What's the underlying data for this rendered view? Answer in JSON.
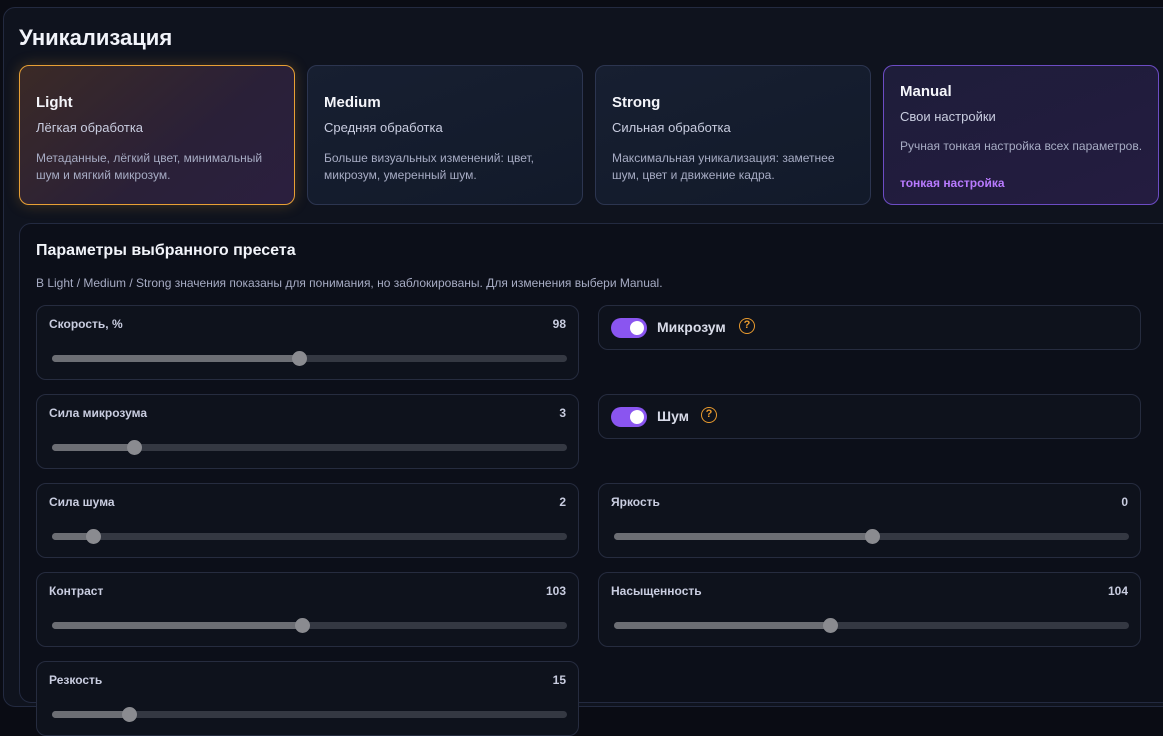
{
  "page": {
    "title": "Уникализация"
  },
  "presets": [
    {
      "name": "Light",
      "subtitle": "Лёгкая обработка",
      "description": "Метаданные, лёгкий цвет, минимальный шум и мягкий микрозум.",
      "active": true
    },
    {
      "name": "Medium",
      "subtitle": "Средняя обработка",
      "description": "Больше визуальных изменений: цвет, микрозум, умеренный шум.",
      "active": false
    },
    {
      "name": "Strong",
      "subtitle": "Сильная обработка",
      "description": "Максимальная уникализация: заметнее шум, цвет и движение кадра.",
      "active": false
    },
    {
      "name": "Manual",
      "subtitle": "Свои настройки",
      "description": "Ручная тонкая настройка всех параметров.",
      "link": "тонкая настройка",
      "active": false
    }
  ],
  "params": {
    "title": "Параметры выбранного пресета",
    "note": "В Light / Medium / Strong значения показаны для понимания, но заблокированы. Для изменения выбери Manual.",
    "sliders": {
      "speed": {
        "label": "Скорость, %",
        "value": "98",
        "fraction": 0.48
      },
      "microzoom_strength": {
        "label": "Сила микрозума",
        "value": "3",
        "fraction": 0.16
      },
      "noise_strength": {
        "label": "Сила шума",
        "value": "2",
        "fraction": 0.08
      },
      "brightness": {
        "label": "Яркость",
        "value": "0",
        "fraction": 0.5
      },
      "contrast": {
        "label": "Контраст",
        "value": "103",
        "fraction": 0.485
      },
      "saturation": {
        "label": "Насыщенность",
        "value": "104",
        "fraction": 0.42
      },
      "sharpness": {
        "label": "Резкость",
        "value": "15",
        "fraction": 0.15
      }
    },
    "toggles": {
      "microzoom": {
        "label": "Микрозум",
        "on": true,
        "help": "?"
      },
      "noise": {
        "label": "Шум",
        "on": true,
        "help": "?"
      }
    }
  },
  "colors": {
    "accent_active_preset": "#e8a035",
    "accent_manual": "#b87aff",
    "toggle_on": "#8a55f0",
    "help_icon": "#e89a2e"
  }
}
